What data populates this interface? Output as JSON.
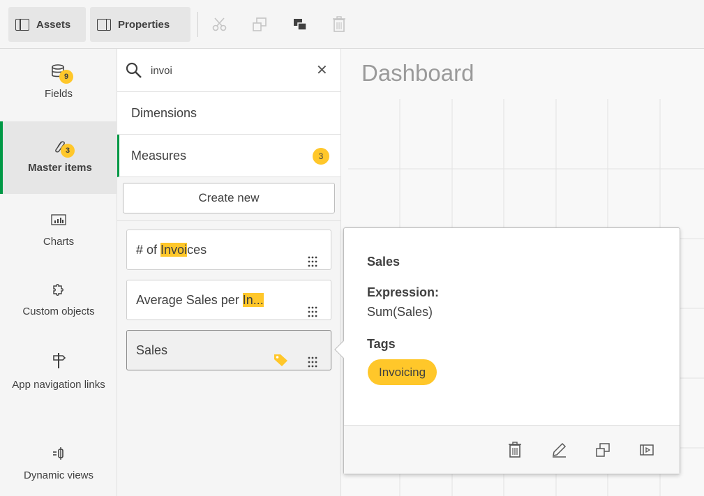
{
  "toolbar": {
    "assets_label": "Assets",
    "properties_label": "Properties",
    "icons": [
      "cut-icon",
      "duplicate-icon",
      "send-to-back-icon",
      "delete-icon"
    ]
  },
  "leftnav": {
    "items": [
      {
        "label": "Fields",
        "icon": "database-icon",
        "badge": "9"
      },
      {
        "label": "Master items",
        "icon": "link-icon",
        "badge": "3",
        "active": true
      },
      {
        "label": "Charts",
        "icon": "chart-icon"
      },
      {
        "label": "Custom objects",
        "icon": "puzzle-icon"
      },
      {
        "label": "App navigation links",
        "icon": "signpost-icon"
      },
      {
        "label": "Dynamic views",
        "icon": "dynamic-view-icon"
      }
    ]
  },
  "panel": {
    "search_value": "invoi",
    "sections": {
      "dimensions": "Dimensions",
      "measures": "Measures",
      "measures_count": "3"
    },
    "create_new": "Create new",
    "items": [
      {
        "pre": "# of ",
        "match": "Invoi",
        "post": "ces"
      },
      {
        "pre": "Average Sales per ",
        "match": "In...",
        "post": ""
      },
      {
        "pre": "Sales",
        "match": "",
        "post": "",
        "tagged": true
      }
    ]
  },
  "canvas": {
    "title": "Dashboard"
  },
  "popover": {
    "title": "Sales",
    "expression_label": "Expression:",
    "expression_value": "Sum(Sales)",
    "tags_label": "Tags",
    "tag": "Invoicing",
    "footer_icons": [
      "delete-icon",
      "edit-icon",
      "duplicate-icon",
      "preview-icon"
    ]
  },
  "colors": {
    "accent_green": "#009845",
    "badge_yellow": "#ffc72a",
    "text": "#404040"
  }
}
